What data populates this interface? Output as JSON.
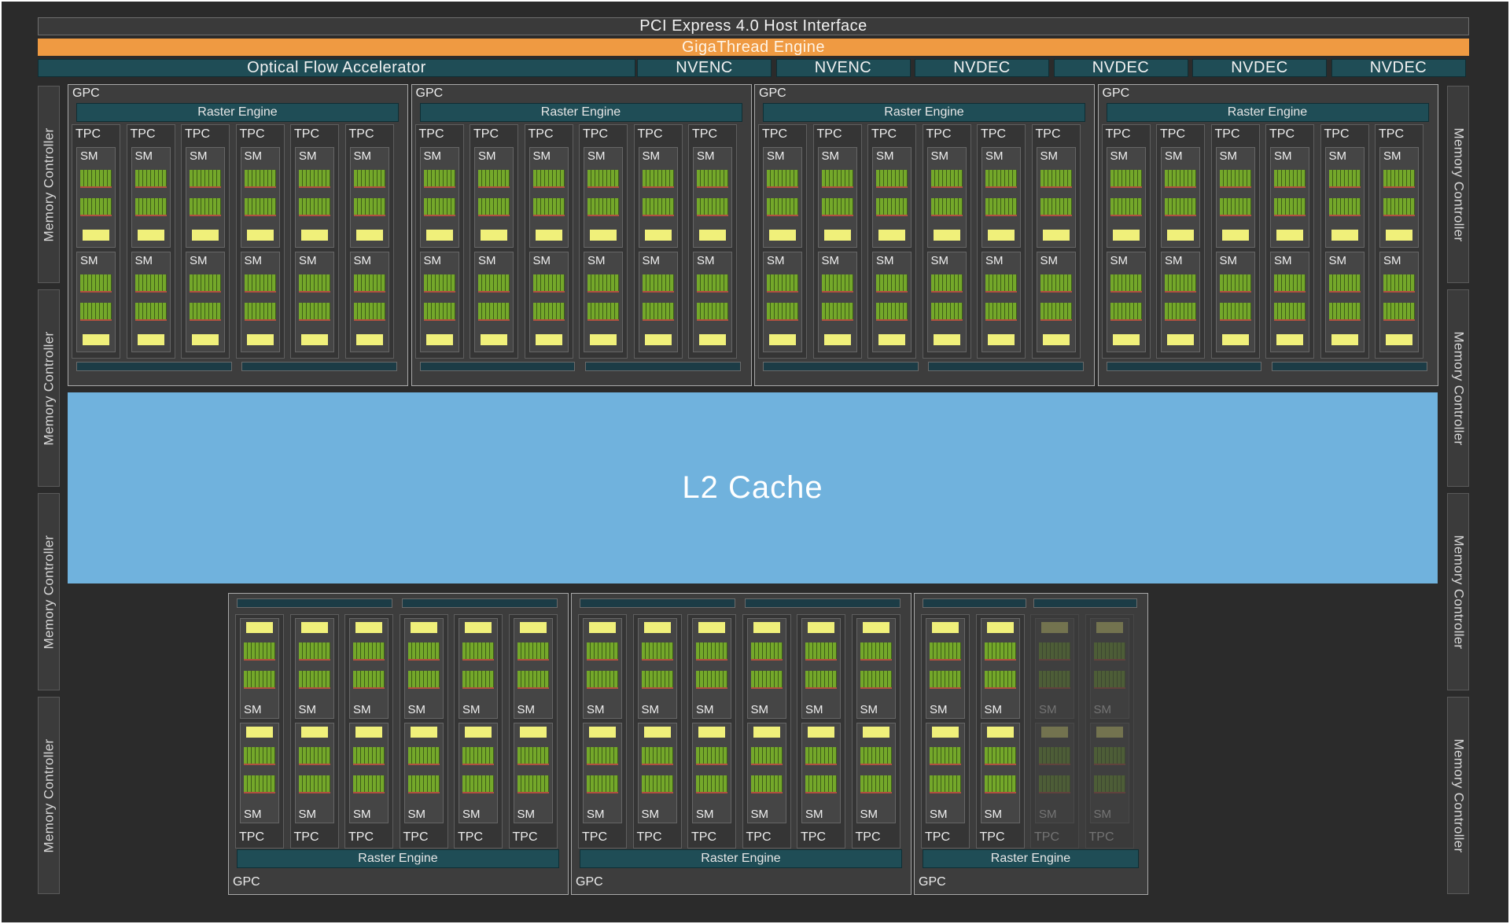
{
  "host_interface": "PCI Express 4.0 Host Interface",
  "gigathread": "GigaThread Engine",
  "optical_flow": "Optical Flow Accelerator",
  "media_engines": [
    "NVENC",
    "NVENC",
    "NVDEC",
    "NVDEC",
    "NVDEC",
    "NVDEC"
  ],
  "memory_controller_label": "Memory Controller",
  "l2_cache": "L2 Cache",
  "gpc_label": "GPC",
  "raster_engine_label": "Raster Engine",
  "tpc_label": "TPC",
  "sm_label": "SM",
  "top_gpc_count": 4,
  "bottom_gpcs": [
    {
      "tpcs_enabled": [
        true,
        true,
        true,
        true,
        true,
        true
      ]
    },
    {
      "tpcs_enabled": [
        true,
        true,
        true,
        true,
        true,
        true
      ]
    },
    {
      "tpcs_enabled": [
        true,
        true,
        false,
        false
      ]
    }
  ],
  "colors": {
    "background": "#2b2b2b",
    "gigathread": "#ef9a42",
    "teal": "#1f4d56",
    "l2_cache": "#70b2dd",
    "cuda_core": "#74a82a",
    "cache": "#f0f07a"
  }
}
